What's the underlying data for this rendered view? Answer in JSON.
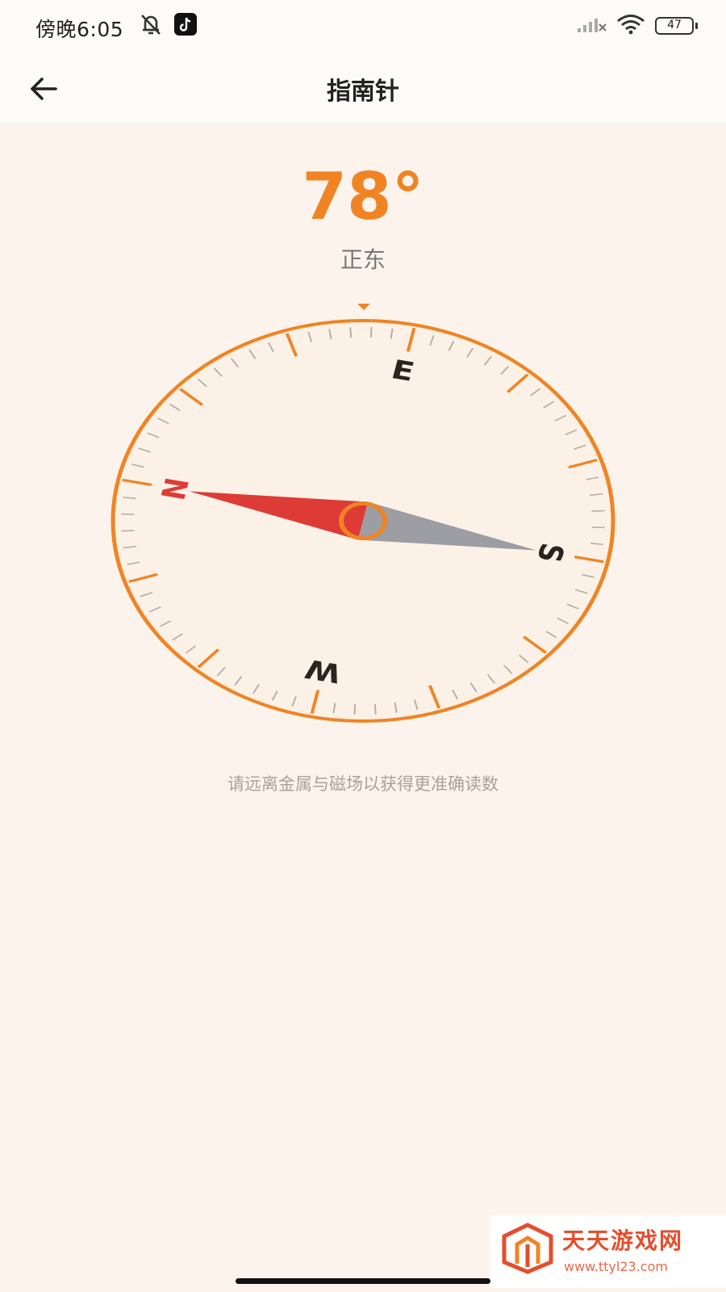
{
  "status_bar": {
    "time": "傍晚6:05",
    "battery": "47",
    "icons": [
      "mute-bell-icon",
      "tiktok-icon",
      "signal-icon",
      "wifi-icon",
      "battery-icon"
    ]
  },
  "app_bar": {
    "title": "指南针",
    "back_icon": "back-arrow-icon"
  },
  "compass": {
    "heading": "78°",
    "heading_degrees": 78,
    "direction": "正东",
    "cardinals": [
      "N",
      "E",
      "S",
      "W"
    ],
    "colors": {
      "accent": "#f08424",
      "north_needle": "#de3b36",
      "south_needle": "#9c9ea3",
      "dial": "#fbf1e6"
    }
  },
  "hint": "请远离金属与磁场以获得更准确读数",
  "watermark": {
    "title": "天天游戏网",
    "url": "www.ttyl23.com"
  }
}
